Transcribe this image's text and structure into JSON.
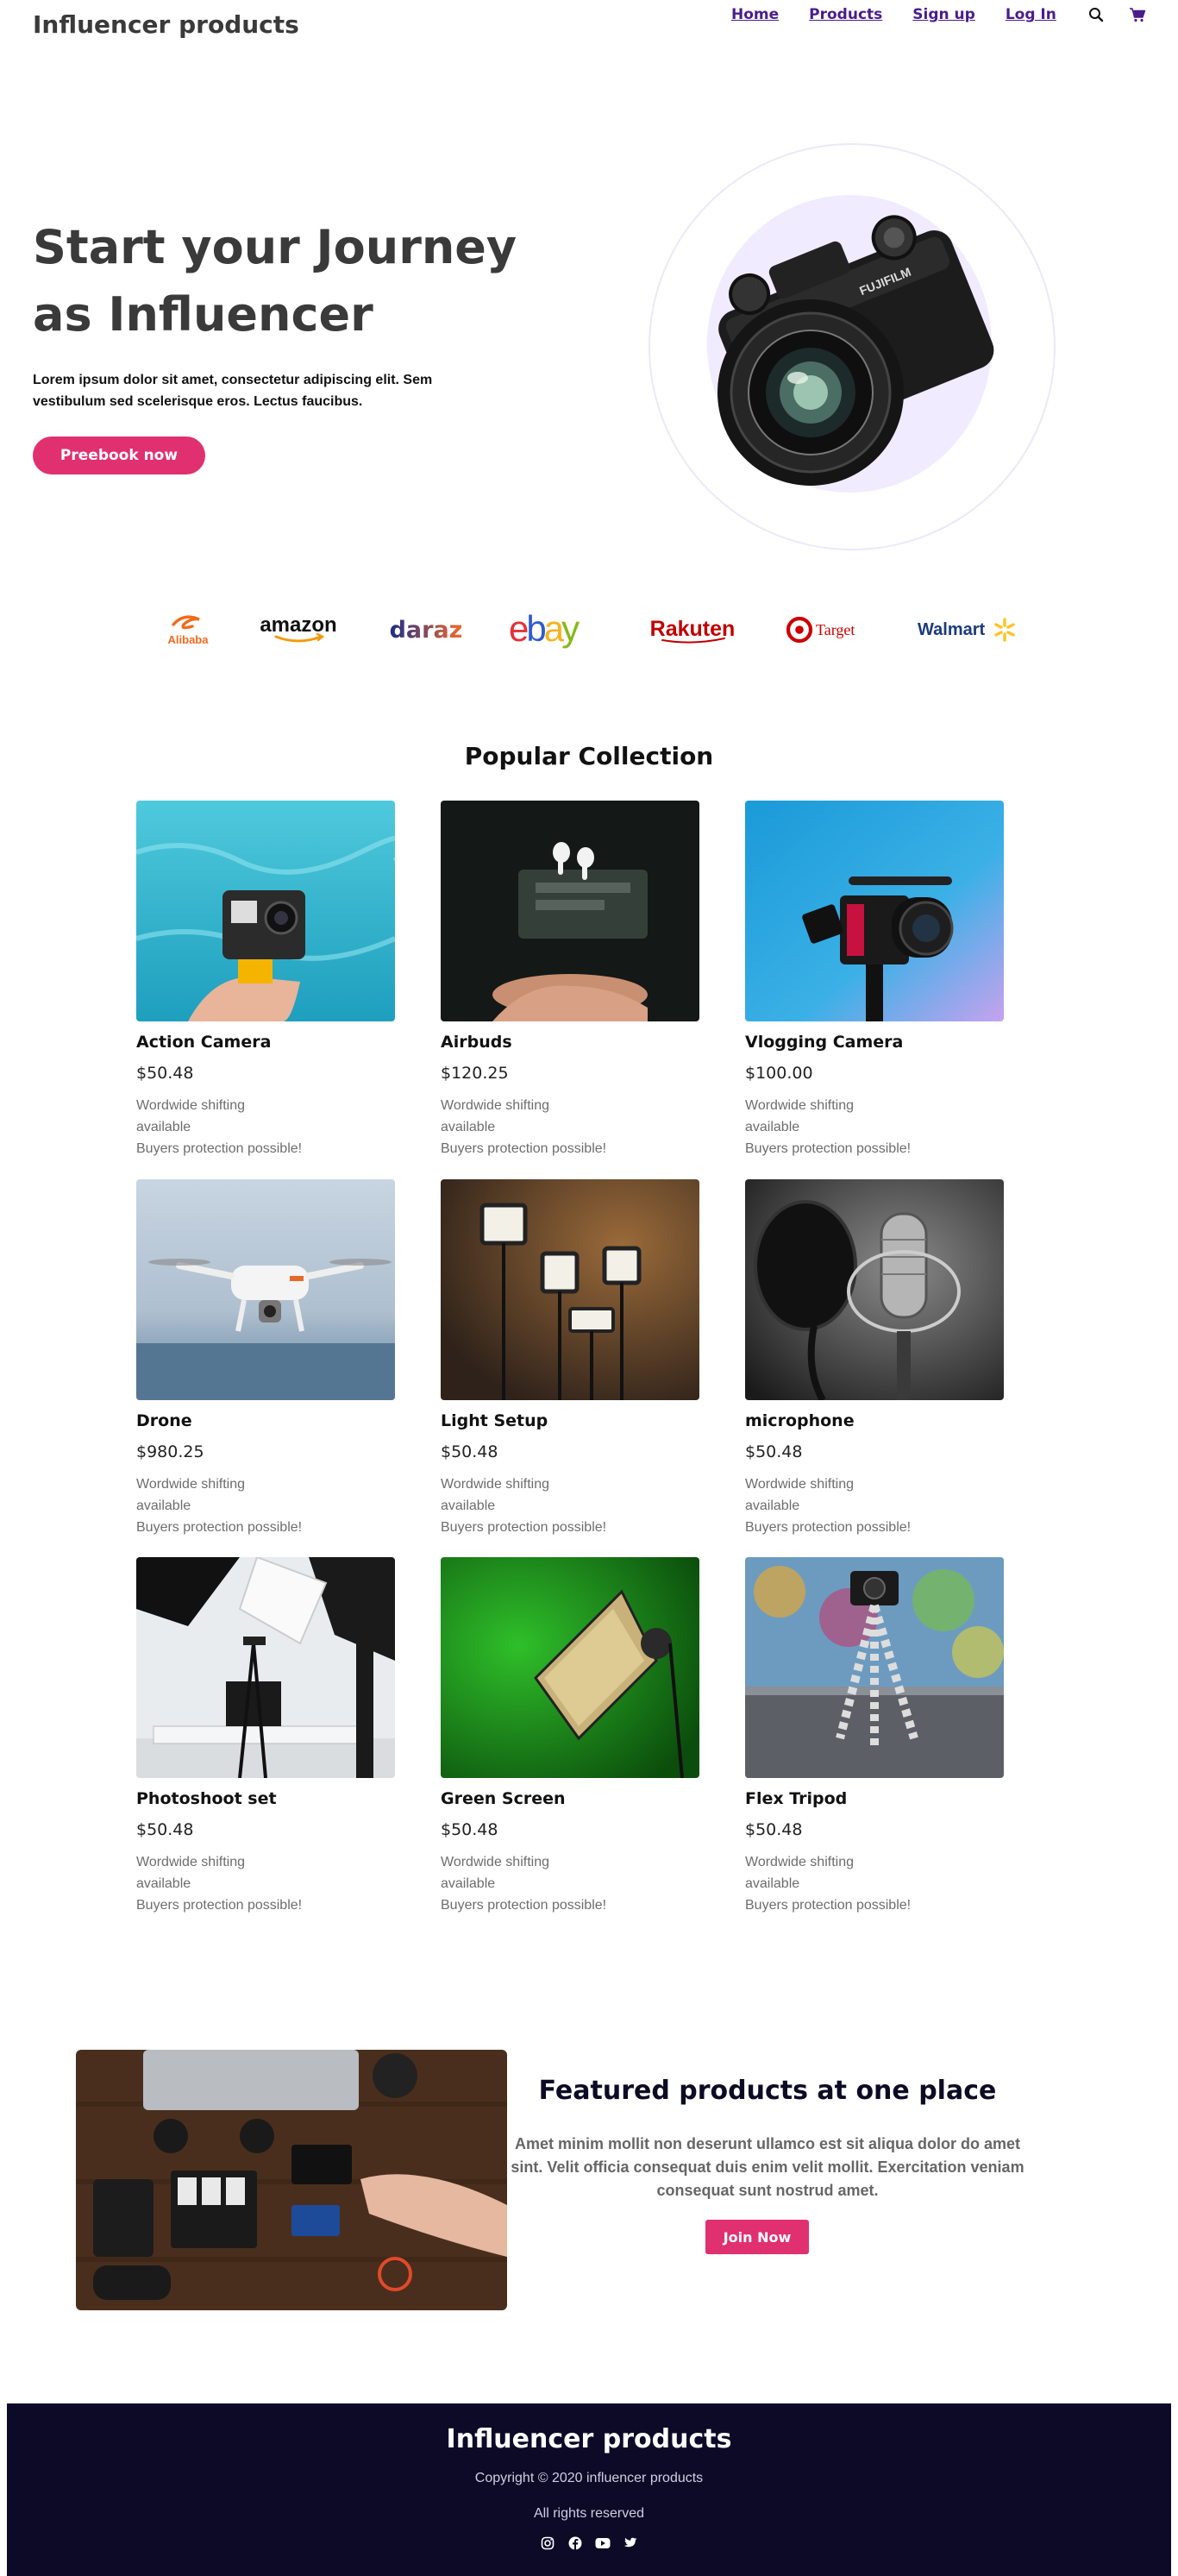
{
  "nav": {
    "brand": "Influencer products",
    "links": [
      "Home",
      "Products",
      "Sign up",
      "Log In"
    ],
    "icons": [
      "search-icon",
      "cart-icon"
    ]
  },
  "hero": {
    "title": "Start your Journey as Influencer",
    "text": "Lorem ipsum dolor sit amet, consectetur adipiscing elit. Sem vestibulum sed scelerisque eros. Lectus faucibus.",
    "button": "Preebook now"
  },
  "logos": {
    "alibaba": "Alibaba",
    "amazon": "amazon",
    "daraz": "daraz",
    "ebay": [
      "e",
      "b",
      "a",
      "y"
    ],
    "rakuten": "Rakuten",
    "target": "Target",
    "walmart": "Walmart"
  },
  "collection": {
    "title": "Popular Collection",
    "shipping": "Wordwide shifting available",
    "protection": "Buyers protection possible!",
    "items": [
      {
        "name": "Action Camera",
        "price": "$50.48"
      },
      {
        "name": "Airbuds",
        "price": "$120.25"
      },
      {
        "name": "Vlogging Camera",
        "price": "$100.00"
      },
      {
        "name": "Drone",
        "price": "$980.25"
      },
      {
        "name": "Light Setup",
        "price": "$50.48"
      },
      {
        "name": "microphone",
        "price": "$50.48"
      },
      {
        "name": "Photoshoot set",
        "price": "$50.48"
      },
      {
        "name": "Green Screen",
        "price": "$50.48"
      },
      {
        "name": "Flex Tripod",
        "price": "$50.48"
      }
    ]
  },
  "featured": {
    "title": "Featured products at one place",
    "text": "Amet minim mollit non deserunt ullamco est sit aliqua dolor do amet sint. Velit officia consequat duis enim velit mollit. Exercitation veniam consequat sunt nostrud amet.",
    "button": "Join Now"
  },
  "footer": {
    "brand": "Influencer products",
    "copyright": "Copyright © 2020 influencer products",
    "rights": "All rights reserved",
    "socials": [
      "instagram-icon",
      "facebook-icon",
      "youtube-icon",
      "twitter-icon"
    ]
  },
  "colors": {
    "accent": "#e0306f",
    "nav_link": "#4a1d8a",
    "footer_bg": "#0d0a28"
  }
}
